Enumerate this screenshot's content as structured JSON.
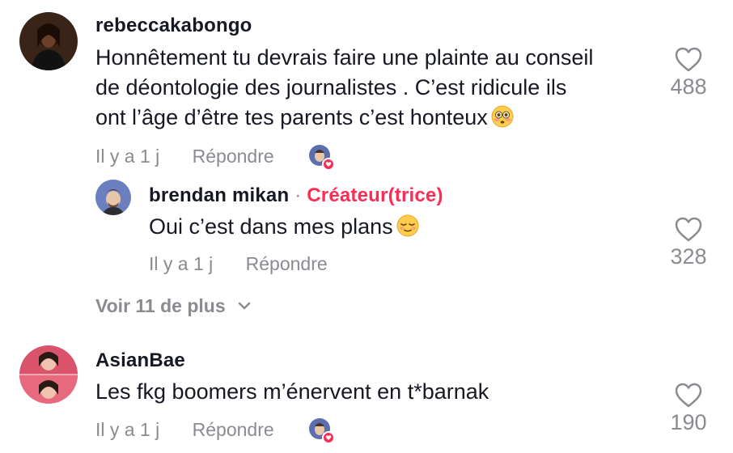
{
  "comments": [
    {
      "username": "rebeccakabongo",
      "text_lines": [
        "Honnêtement tu devrais faire une plainte au conseil",
        "de déontologie des journalistes . C’est ridicule ils",
        "ont l’âge d’être tes parents c’est honteux"
      ],
      "emoji": "flushed-face",
      "time": "Il y a 1 j",
      "reply_label": "Répondre",
      "likes": "488",
      "liked_by_creator": true
    },
    {
      "username": "brendan mikan",
      "separator": "·",
      "badge": "Créateur(trice)",
      "text": "Oui c’est dans mes plans",
      "emoji": "relieved-face",
      "time": "Il y a 1 j",
      "reply_label": "Répondre",
      "likes": "328"
    },
    {
      "username": "AsianBae",
      "text": "Les fkg boomers m’énervent en t*barnak",
      "time": "Il y a 1 j",
      "reply_label": "Répondre",
      "likes": "190",
      "liked_by_creator": true
    }
  ],
  "view_more": {
    "label": "Voir 11 de plus",
    "icon": "chevron-down-icon"
  },
  "colors": {
    "text": "#161823",
    "muted": "#8a8b91",
    "creator": "#fe2c55"
  }
}
